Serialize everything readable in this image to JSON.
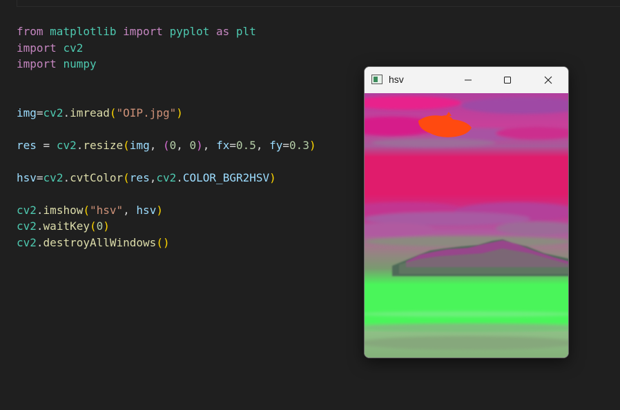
{
  "editor": {
    "lines": [
      [
        {
          "t": "from",
          "c": "kw"
        },
        {
          "t": " ",
          "c": "op"
        },
        {
          "t": "matplotlib",
          "c": "mod"
        },
        {
          "t": " ",
          "c": "op"
        },
        {
          "t": "import",
          "c": "kw"
        },
        {
          "t": " ",
          "c": "op"
        },
        {
          "t": "pyplot",
          "c": "mod"
        },
        {
          "t": " ",
          "c": "op"
        },
        {
          "t": "as",
          "c": "kw"
        },
        {
          "t": " ",
          "c": "op"
        },
        {
          "t": "plt",
          "c": "mod"
        }
      ],
      [
        {
          "t": "import",
          "c": "kw"
        },
        {
          "t": " ",
          "c": "op"
        },
        {
          "t": "cv2",
          "c": "mod"
        }
      ],
      [
        {
          "t": "import",
          "c": "kw"
        },
        {
          "t": " ",
          "c": "op"
        },
        {
          "t": "numpy",
          "c": "mod"
        }
      ],
      [],
      [],
      [
        {
          "t": "img",
          "c": "var"
        },
        {
          "t": "=",
          "c": "op"
        },
        {
          "t": "cv2",
          "c": "mod"
        },
        {
          "t": ".",
          "c": "op"
        },
        {
          "t": "imread",
          "c": "fn"
        },
        {
          "t": "(",
          "c": "p1"
        },
        {
          "t": "\"OIP.jpg\"",
          "c": "str"
        },
        {
          "t": ")",
          "c": "p1"
        }
      ],
      [],
      [
        {
          "t": "res",
          "c": "var"
        },
        {
          "t": " = ",
          "c": "op"
        },
        {
          "t": "cv2",
          "c": "mod"
        },
        {
          "t": ".",
          "c": "op"
        },
        {
          "t": "resize",
          "c": "fn"
        },
        {
          "t": "(",
          "c": "p1"
        },
        {
          "t": "img",
          "c": "var"
        },
        {
          "t": ", ",
          "c": "op"
        },
        {
          "t": "(",
          "c": "p2"
        },
        {
          "t": "0",
          "c": "num"
        },
        {
          "t": ", ",
          "c": "op"
        },
        {
          "t": "0",
          "c": "num"
        },
        {
          "t": ")",
          "c": "p2"
        },
        {
          "t": ", ",
          "c": "op"
        },
        {
          "t": "fx",
          "c": "var"
        },
        {
          "t": "=",
          "c": "op"
        },
        {
          "t": "0.5",
          "c": "num"
        },
        {
          "t": ", ",
          "c": "op"
        },
        {
          "t": "fy",
          "c": "var"
        },
        {
          "t": "=",
          "c": "op"
        },
        {
          "t": "0.3",
          "c": "num"
        },
        {
          "t": ")",
          "c": "p1"
        }
      ],
      [],
      [
        {
          "t": "hsv",
          "c": "var"
        },
        {
          "t": "=",
          "c": "op"
        },
        {
          "t": "cv2",
          "c": "mod"
        },
        {
          "t": ".",
          "c": "op"
        },
        {
          "t": "cvtColor",
          "c": "fn"
        },
        {
          "t": "(",
          "c": "p1"
        },
        {
          "t": "res",
          "c": "var"
        },
        {
          "t": ",",
          "c": "op"
        },
        {
          "t": "cv2",
          "c": "mod"
        },
        {
          "t": ".",
          "c": "op"
        },
        {
          "t": "COLOR_BGR2HSV",
          "c": "var"
        },
        {
          "t": ")",
          "c": "p1"
        }
      ],
      [],
      [
        {
          "t": "cv2",
          "c": "mod"
        },
        {
          "t": ".",
          "c": "op"
        },
        {
          "t": "imshow",
          "c": "fn"
        },
        {
          "t": "(",
          "c": "p1"
        },
        {
          "t": "\"hsv\"",
          "c": "str"
        },
        {
          "t": ", ",
          "c": "op"
        },
        {
          "t": "hsv",
          "c": "var"
        },
        {
          "t": ")",
          "c": "p1"
        }
      ],
      [
        {
          "t": "cv2",
          "c": "mod"
        },
        {
          "t": ".",
          "c": "op"
        },
        {
          "t": "waitKey",
          "c": "fn"
        },
        {
          "t": "(",
          "c": "p1"
        },
        {
          "t": "0",
          "c": "num"
        },
        {
          "t": ")",
          "c": "p1"
        }
      ],
      [
        {
          "t": "cv2",
          "c": "mod"
        },
        {
          "t": ".",
          "c": "op"
        },
        {
          "t": "destroyAllWindows",
          "c": "fn"
        },
        {
          "t": "()",
          "c": "p1"
        }
      ]
    ]
  },
  "window": {
    "title": "hsv",
    "icons": {
      "app": "app-window-icon",
      "minimize": "minimize-icon",
      "maximize": "maximize-icon",
      "close": "close-icon"
    }
  },
  "colors": {
    "editor_bg": "#1f1f1f",
    "image_sky_magenta": "#e01c6c",
    "image_cloud_purple": "#a846a8",
    "image_ground_green": "#4af55a",
    "image_sun_orange": "#ff4a10"
  }
}
